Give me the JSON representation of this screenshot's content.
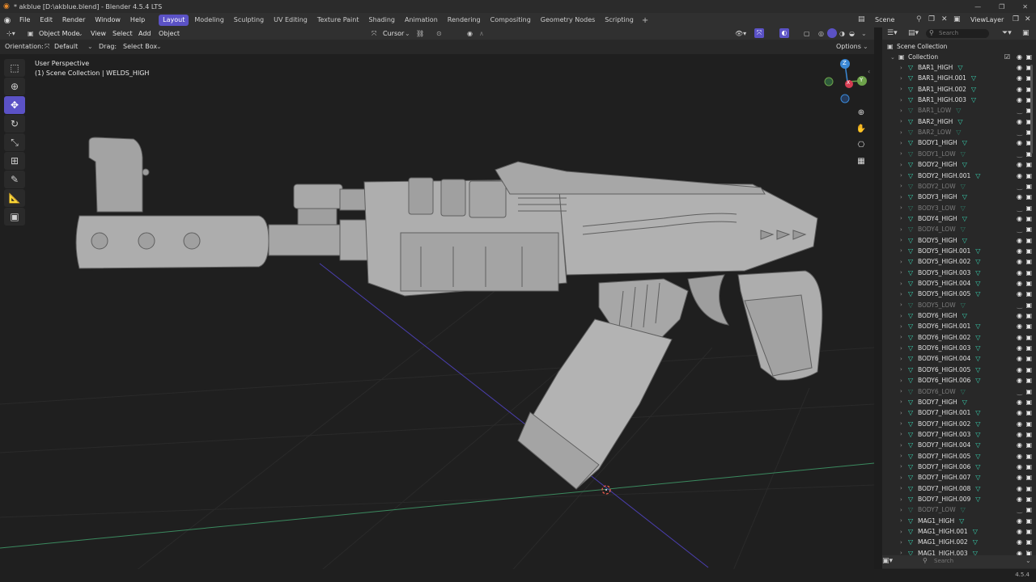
{
  "window": {
    "title": "* akblue [D:\\akblue.blend] - Blender 4.5.4 LTS"
  },
  "menus": [
    "File",
    "Edit",
    "Render",
    "Window",
    "Help"
  ],
  "workspaces": [
    "Layout",
    "Modeling",
    "Sculpting",
    "UV Editing",
    "Texture Paint",
    "Shading",
    "Animation",
    "Rendering",
    "Compositing",
    "Geometry Nodes",
    "Scripting"
  ],
  "active_workspace": "Layout",
  "scene": {
    "name": "Scene",
    "view_layer": "ViewLayer"
  },
  "view3d_header": {
    "mode": "Object Mode",
    "view": "View",
    "select": "Select",
    "add": "Add",
    "object": "Object",
    "snap": "Cursor"
  },
  "tool_header": {
    "orientation_label": "Orientation:",
    "orientation_value": "Default",
    "drag_label": "Drag:",
    "drag_value": "Select Box",
    "options": "Options"
  },
  "viewport": {
    "perspective": "User Perspective",
    "collection_info": "(1) Scene Collection | WELDS_HIGH",
    "gizmo": {
      "z": "Z",
      "y": "Y",
      "x": "X"
    }
  },
  "outliner": {
    "search_placeholder": "Search",
    "root": "Scene Collection",
    "collection": "Collection",
    "items": [
      {
        "name": "BAR1_HIGH",
        "visible": true
      },
      {
        "name": "BAR1_HIGH.001",
        "visible": true
      },
      {
        "name": "BAR1_HIGH.002",
        "visible": true
      },
      {
        "name": "BAR1_HIGH.003",
        "visible": true
      },
      {
        "name": "BAR1_LOW",
        "visible": false
      },
      {
        "name": "BAR2_HIGH",
        "visible": true
      },
      {
        "name": "BAR2_LOW",
        "visible": false
      },
      {
        "name": "BODY1_HIGH",
        "visible": true
      },
      {
        "name": "BODY1_LOW",
        "visible": false
      },
      {
        "name": "BODY2_HIGH",
        "visible": true
      },
      {
        "name": "BODY2_HIGH.001",
        "visible": true
      },
      {
        "name": "BODY2_LOW",
        "visible": false
      },
      {
        "name": "BODY3_HIGH",
        "visible": true
      },
      {
        "name": "BODY3_LOW",
        "visible": false
      },
      {
        "name": "BODY4_HIGH",
        "visible": true
      },
      {
        "name": "BODY4_LOW",
        "visible": false
      },
      {
        "name": "BODY5_HIGH",
        "visible": true
      },
      {
        "name": "BODY5_HIGH.001",
        "visible": true
      },
      {
        "name": "BODY5_HIGH.002",
        "visible": true
      },
      {
        "name": "BODY5_HIGH.003",
        "visible": true
      },
      {
        "name": "BODY5_HIGH.004",
        "visible": true
      },
      {
        "name": "BODY5_HIGH.005",
        "visible": true
      },
      {
        "name": "BODY5_LOW",
        "visible": false
      },
      {
        "name": "BODY6_HIGH",
        "visible": true
      },
      {
        "name": "BODY6_HIGH.001",
        "visible": true
      },
      {
        "name": "BODY6_HIGH.002",
        "visible": true
      },
      {
        "name": "BODY6_HIGH.003",
        "visible": true
      },
      {
        "name": "BODY6_HIGH.004",
        "visible": true
      },
      {
        "name": "BODY6_HIGH.005",
        "visible": true
      },
      {
        "name": "BODY6_HIGH.006",
        "visible": true
      },
      {
        "name": "BODY6_LOW",
        "visible": false
      },
      {
        "name": "BODY7_HIGH",
        "visible": true
      },
      {
        "name": "BODY7_HIGH.001",
        "visible": true
      },
      {
        "name": "BODY7_HIGH.002",
        "visible": true
      },
      {
        "name": "BODY7_HIGH.003",
        "visible": true
      },
      {
        "name": "BODY7_HIGH.004",
        "visible": true
      },
      {
        "name": "BODY7_HIGH.005",
        "visible": true
      },
      {
        "name": "BODY7_HIGH.006",
        "visible": true
      },
      {
        "name": "BODY7_HIGH.007",
        "visible": true
      },
      {
        "name": "BODY7_HIGH.008",
        "visible": true
      },
      {
        "name": "BODY7_HIGH.009",
        "visible": true
      },
      {
        "name": "BODY7_LOW",
        "visible": false
      },
      {
        "name": "MAG1_HIGH",
        "visible": true
      },
      {
        "name": "MAG1_HIGH.001",
        "visible": true
      },
      {
        "name": "MAG1_HIGH.002",
        "visible": true
      },
      {
        "name": "MAG1_HIGH.003",
        "visible": true
      }
    ]
  },
  "bottom_search_placeholder": "Search",
  "version": "4.5.4",
  "colors": {
    "accent": "#5b52c6",
    "mesh_icon": "#38d5b3",
    "x_axis": "#d63c52",
    "y_axis": "#6da24a",
    "z_axis": "#3a88d6"
  }
}
